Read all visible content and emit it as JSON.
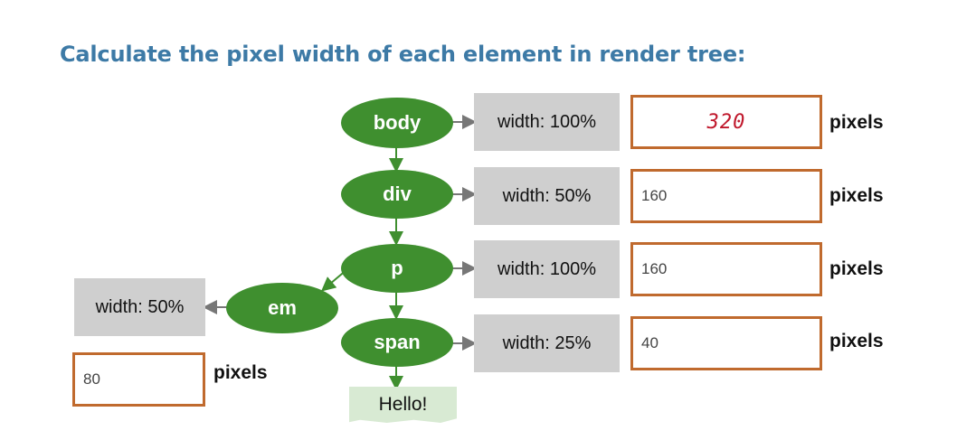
{
  "title": "Calculate the pixel width of each element in render tree:",
  "tree": {
    "nodes": {
      "body": "body",
      "div": "div",
      "p": "p",
      "em": "em",
      "span": "span"
    },
    "leaf_text": "Hello!"
  },
  "rows": {
    "body": {
      "width_label": "width: 100%",
      "answer": "320",
      "unit": "pixels"
    },
    "div": {
      "width_label": "width: 50%",
      "answer": "160",
      "unit": "pixels"
    },
    "p": {
      "width_label": "width: 100%",
      "answer": "160",
      "unit": "pixels"
    },
    "span": {
      "width_label": "width: 25%",
      "answer": "40",
      "unit": "pixels"
    },
    "em": {
      "width_label": "width: 50%",
      "answer": "80",
      "unit": "pixels"
    }
  },
  "colors": {
    "title": "#3d7aa6",
    "node": "#3f8f2f",
    "width_box": "#cfcfcf",
    "answer_border": "#c06a2e",
    "handwriting": "#c0182c",
    "leaf": "#d8ead3"
  }
}
